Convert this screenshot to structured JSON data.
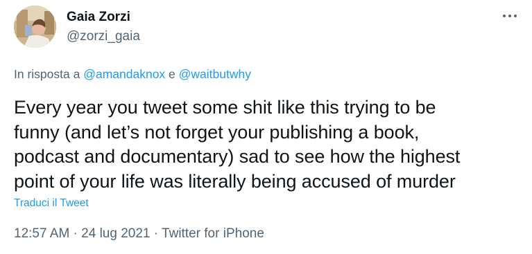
{
  "author": {
    "display_name": "Gaia Zorzi",
    "handle": "@zorzi_gaia"
  },
  "reply": {
    "prefix": "In risposta a ",
    "mention1": "@amandaknox",
    "conjunction": " e ",
    "mention2": "@waitbutwhy"
  },
  "tweet": {
    "lines": [
      "Every year you tweet some shit like this trying to be",
      "funny (and let’s not forget your publishing a book,",
      "podcast and documentary) sad to see how the highest",
      "point of your life was literally being accused of murder"
    ],
    "translate_label": "Traduci il Tweet"
  },
  "meta": {
    "time": "12:57 AM",
    "separator1": " · ",
    "date": "24 lug 2021",
    "separator2": " · ",
    "source": "Twitter for iPhone"
  },
  "icons": {
    "more": "more-horizontal-icon"
  },
  "colors": {
    "link": "#1d9bf0",
    "secondary_text": "#536471",
    "primary_text": "#0f1419"
  }
}
